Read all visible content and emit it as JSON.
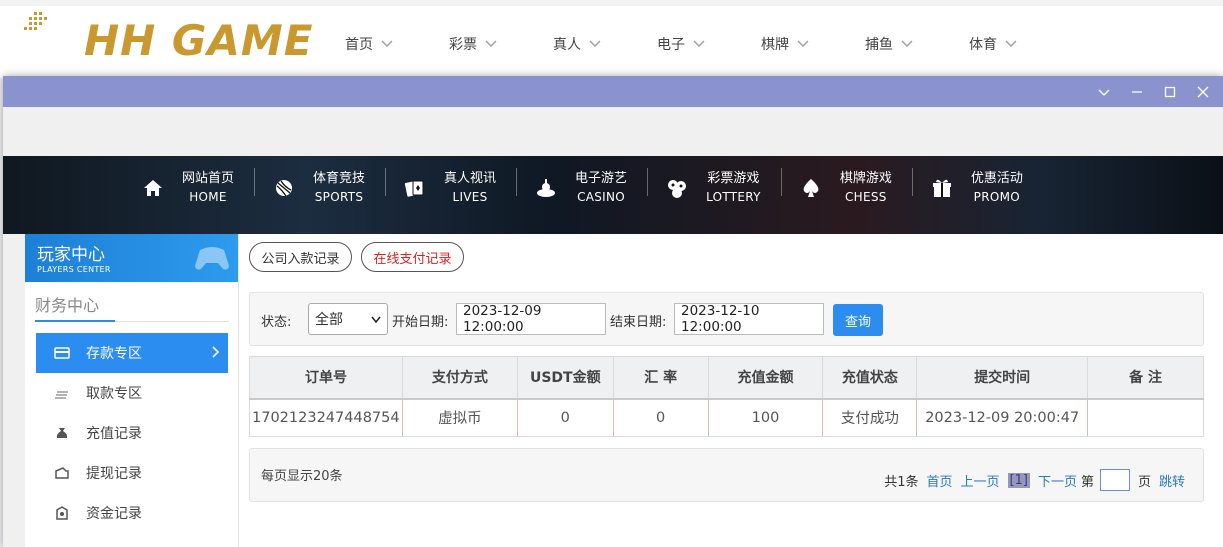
{
  "site": {
    "logo_text": "HH GAME",
    "top_nav": [
      "首页",
      "彩票",
      "真人",
      "电子",
      "棋牌",
      "捕鱼",
      "体育"
    ]
  },
  "banner_nav": [
    {
      "cn": "网站首页",
      "en": "HOME",
      "icon": "home-icon"
    },
    {
      "cn": "体育竞技",
      "en": "SPORTS",
      "icon": "ball-icon"
    },
    {
      "cn": "真人视讯",
      "en": "LIVES",
      "icon": "cards-icon"
    },
    {
      "cn": "电子游艺",
      "en": "CASINO",
      "icon": "slot-icon"
    },
    {
      "cn": "彩票游戏",
      "en": "LOTTERY",
      "icon": "lottery-balls-icon"
    },
    {
      "cn": "棋牌游戏",
      "en": "CHESS",
      "icon": "spade-icon"
    },
    {
      "cn": "优惠活动",
      "en": "PROMO",
      "icon": "gift-icon"
    }
  ],
  "sidebar": {
    "title": "玩家中心",
    "subtitle": "PLAYERS CENTER",
    "section": "财务中心",
    "items": [
      {
        "label": "存款专区",
        "icon": "card-icon",
        "active": true
      },
      {
        "label": "取款专区",
        "icon": "cash-icon",
        "active": false
      },
      {
        "label": "充值记录",
        "icon": "money-bag-icon",
        "active": false
      },
      {
        "label": "提现记录",
        "icon": "wallet-icon",
        "active": false
      },
      {
        "label": "资金记录",
        "icon": "ledger-icon",
        "active": false
      }
    ]
  },
  "tabs": {
    "company": "公司入款记录",
    "online": "在线支付记录"
  },
  "filter": {
    "status_label": "状态:",
    "status_value": "全部",
    "start_label": "开始日期:",
    "start_value": "2023-12-09 12:00:00",
    "end_label": "结束日期:",
    "end_value": "2023-12-10 12:00:00",
    "query": "查询"
  },
  "table": {
    "headers": [
      "订单号",
      "支付方式",
      "USDT金额",
      "汇 率",
      "充值金额",
      "充值状态",
      "提交时间",
      "备 注"
    ],
    "rows": [
      [
        "1702123247448754",
        "虚拟币",
        "0",
        "0",
        "100",
        "支付成功",
        "2023-12-09 20:00:47",
        ""
      ]
    ]
  },
  "pager": {
    "page_size": "每页显示20条",
    "total": "共1条",
    "first": "首页",
    "prev": "上一页",
    "current": "[1]",
    "next": "下一页",
    "goto_prefix": "第",
    "goto_suffix": "页",
    "jump": "跳转"
  },
  "colors": {
    "accent": "#2c8df0",
    "titlebar": "#8b93cf",
    "logo_gold": "#c9992f",
    "tab_online_text": "#e02020"
  }
}
